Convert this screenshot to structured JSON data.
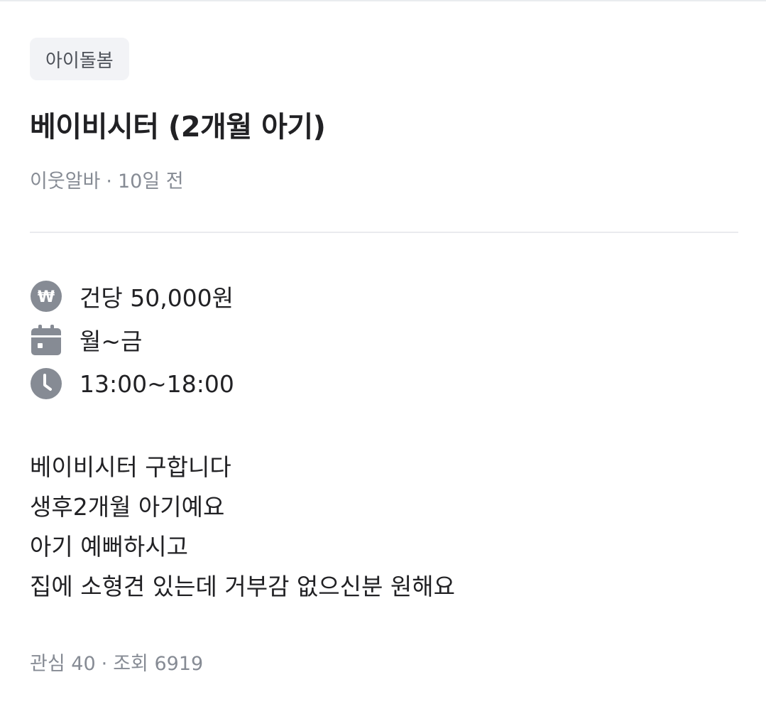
{
  "post": {
    "category": "아이돌봄",
    "title": "베이비시터 (2개월 아기)",
    "author": "이웃알바",
    "separator": "·",
    "posted_ago": "10일 전"
  },
  "details": {
    "pay": {
      "icon": "won-icon",
      "text": "건당 50,000원"
    },
    "days": {
      "icon": "calendar-icon",
      "text": "월~금"
    },
    "time": {
      "icon": "clock-icon",
      "text": "13:00~18:00"
    }
  },
  "description": [
    "베이비시터 구합니다",
    "생후2개월 아기예요",
    "아기 예뻐하시고",
    "집에 소형견 있는데 거부감 없으신분 원해요"
  ],
  "stats": {
    "interest": "관심 40",
    "separator": "·",
    "views": "조회 6919"
  },
  "colors": {
    "text_primary": "#212124",
    "text_secondary": "#868b94",
    "icon_gray": "#868b94",
    "chip_bg": "#f2f3f6",
    "divider": "#eaebee"
  }
}
